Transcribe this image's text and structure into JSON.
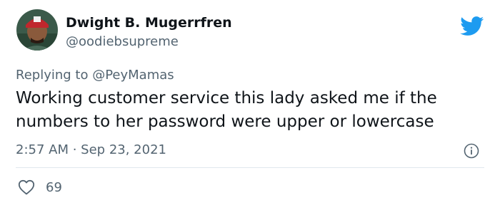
{
  "tweet": {
    "display_name": "Dwight B. Mugerrfren",
    "handle": "@oodiebsupreme",
    "reply_prefix": "Replying to ",
    "reply_to": "@PeyMamas",
    "text": "Working customer service this lady asked me if the numbers to her password were upper or lowercase",
    "time": "2:57 AM",
    "separator": " · ",
    "date": "Sep 23, 2021",
    "like_count": "69"
  },
  "colors": {
    "twitter_blue": "#1d9bf0",
    "secondary_text": "#536471",
    "primary_text": "#0f1419",
    "divider": "#e1e8ed"
  },
  "icons": {
    "brand": "twitter-bird-icon",
    "info": "info-icon",
    "like": "heart-icon"
  }
}
